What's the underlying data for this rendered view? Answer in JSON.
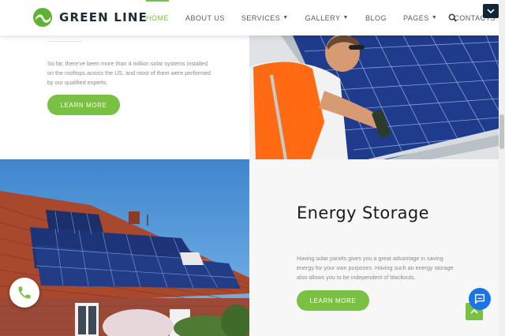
{
  "header": {
    "brand": "GREEN LINE",
    "logo_icon": "green-line-logo-icon",
    "nav": [
      {
        "label": "HOME",
        "active": true,
        "has_dropdown": false
      },
      {
        "label": "ABOUT US",
        "active": false,
        "has_dropdown": false
      },
      {
        "label": "SERVICES",
        "active": false,
        "has_dropdown": true
      },
      {
        "label": "GALLERY",
        "active": false,
        "has_dropdown": true
      },
      {
        "label": "BLOG",
        "active": false,
        "has_dropdown": false
      },
      {
        "label": "PAGES",
        "active": false,
        "has_dropdown": true
      },
      {
        "label": "CONTACTS",
        "active": false,
        "has_dropdown": false
      }
    ],
    "search_icon": "search-icon",
    "corner_toggle_icon": "chevron-down-icon"
  },
  "section_one": {
    "text": "So far, there've been more than 4 million solar systems installed on the rooftops across the US, and most of them were performed by our qualified experts.",
    "button_label": "LEARN MORE",
    "image_subject": "worker installing solar panel"
  },
  "section_two": {
    "title": "Energy Storage",
    "text": "Having solar panels gives you a great advantage in saving energy for your own purposes. Having such an energy storage also allows you to be independent of blackouts.",
    "button_label": "LEARN MORE",
    "image_subject": "house roof with solar panels"
  },
  "floating": {
    "phone_icon": "phone-icon",
    "chat_icon": "chat-icon",
    "to_top_icon": "arrow-up-icon"
  },
  "colors": {
    "accent": "#7ac143",
    "dark": "#1e2b30",
    "chat": "#1a73e8",
    "toggle": "#12263a"
  }
}
